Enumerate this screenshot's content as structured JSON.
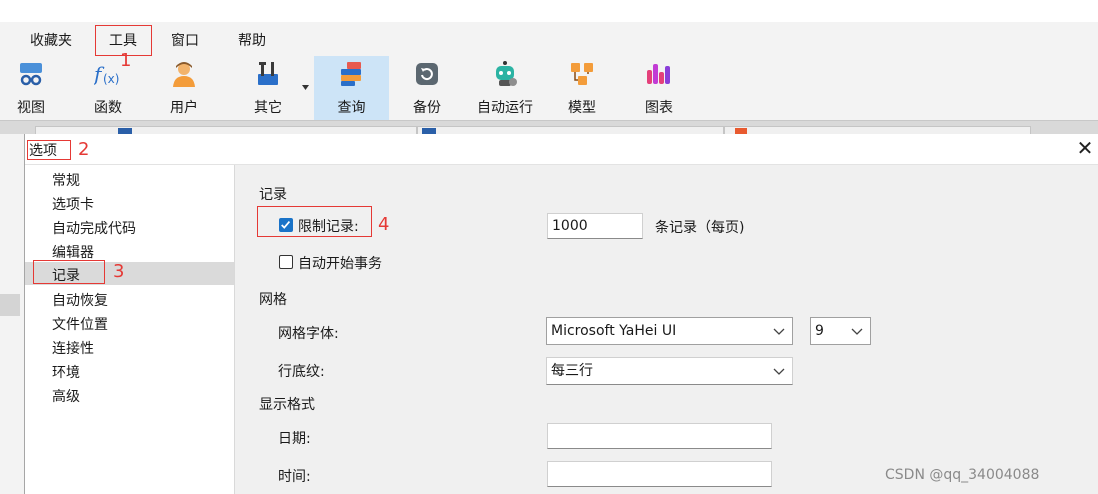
{
  "menu": [
    "收藏夹",
    "工具",
    "窗口",
    "帮助"
  ],
  "toolbar": [
    {
      "label": "视图",
      "icon": "view-icon"
    },
    {
      "label": "函数",
      "icon": "function-icon"
    },
    {
      "label": "用户",
      "icon": "user-icon"
    },
    {
      "label": "其它",
      "icon": "tools-icon"
    },
    {
      "label": "查询",
      "icon": "query-icon",
      "active": true
    },
    {
      "label": "备份",
      "icon": "backup-icon"
    },
    {
      "label": "自动运行",
      "icon": "robot-icon"
    },
    {
      "label": "模型",
      "icon": "model-icon"
    },
    {
      "label": "图表",
      "icon": "chart-icon"
    }
  ],
  "dialog": {
    "title": "选项",
    "close": "✕",
    "nav": [
      "常规",
      "选项卡",
      "自动完成代码",
      "编辑器",
      "记录",
      "自动恢复",
      "文件位置",
      "连接性",
      "环境",
      "高级"
    ],
    "selected_nav": "记录",
    "record": {
      "section": "记录",
      "limit_label": "限制记录:",
      "limit_checked": true,
      "limit_value": "1000",
      "limit_unit": "条记录（每页)",
      "autotx_label": "自动开始事务",
      "autotx_checked": false
    },
    "grid": {
      "section": "网格",
      "font_label": "网格字体:",
      "font_value": "Microsoft YaHei UI",
      "size_value": "9",
      "stripe_label": "行底纹:",
      "stripe_value": "每三行"
    },
    "display": {
      "section": "显示格式",
      "date_label": "日期:",
      "date_value": "",
      "time_label": "时间:",
      "time_value": ""
    }
  },
  "annotations": [
    "1",
    "2",
    "3",
    "4"
  ],
  "watermark": "CSDN @qq_34004088",
  "colors": {
    "annotation": "#e53935",
    "accent": "#1a73c8",
    "active_tool": "#cde4f7"
  }
}
